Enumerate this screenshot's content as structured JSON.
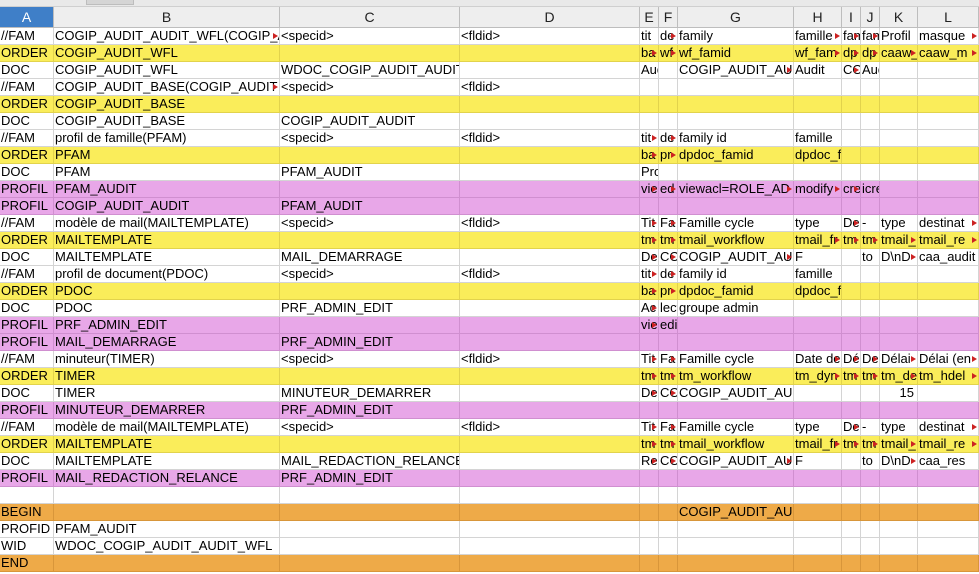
{
  "columns": [
    {
      "label": "A",
      "w": 54
    },
    {
      "label": "B",
      "w": 226
    },
    {
      "label": "C",
      "w": 180
    },
    {
      "label": "D",
      "w": 180
    },
    {
      "label": "E",
      "w": 19
    },
    {
      "label": "F",
      "w": 19
    },
    {
      "label": "G",
      "w": 116
    },
    {
      "label": "H",
      "w": 48
    },
    {
      "label": "I",
      "w": 19
    },
    {
      "label": "J",
      "w": 19
    },
    {
      "label": "K",
      "w": 38
    },
    {
      "label": "L",
      "w": 61
    }
  ],
  "selected_column": "A",
  "rows": [
    {
      "type": "FAM",
      "cells": [
        "//FAM",
        "COGIP_AUDIT_AUDIT_WFL(COGIP_AUDIT",
        "<specid>",
        "<fldid>",
        "tit",
        "de",
        "family",
        "famille",
        "fam",
        "fam",
        "Profil",
        "masque"
      ],
      "trunc": [
        1,
        5,
        7,
        8,
        9,
        11
      ]
    },
    {
      "type": "ORDER",
      "cells": [
        "ORDER",
        "COGIP_AUDIT_WFL",
        "",
        "",
        "ba",
        "wf",
        "wf_famid",
        "wf_fam",
        "dp",
        "dp",
        "caaw_",
        "caaw_m"
      ],
      "trunc": [
        4,
        5,
        7,
        8,
        9,
        10,
        11
      ]
    },
    {
      "type": "DOC",
      "cells": [
        "DOC",
        "COGIP_AUDIT_WFL",
        "WDOC_COGIP_AUDIT_AUDIT_WFL",
        "",
        "Audit",
        "",
        "COGIP_AUDIT_AU",
        "Audit",
        "CO",
        "Audit",
        "",
        ""
      ],
      "trunc": [
        6,
        8
      ]
    },
    {
      "type": "FAM",
      "cells": [
        "//FAM",
        "COGIP_AUDIT_BASE(COGIP_AUDIT",
        "<specid>",
        "<fldid>",
        "",
        "",
        "",
        "",
        "",
        "",
        "",
        ""
      ],
      "trunc": [
        1
      ]
    },
    {
      "type": "ORDER",
      "cells": [
        "ORDER",
        "COGIP_AUDIT_BASE",
        "",
        "",
        "",
        "",
        "",
        "",
        "",
        "",
        "",
        ""
      ],
      "trunc": []
    },
    {
      "type": "DOC",
      "cells": [
        "DOC",
        "COGIP_AUDIT_BASE",
        "COGIP_AUDIT_AUDIT",
        "",
        "",
        "",
        "",
        "",
        "",
        "",
        "",
        ""
      ],
      "trunc": []
    },
    {
      "type": "FAM",
      "cells": [
        "//FAM",
        "profil de famille(PFAM)",
        "<specid>",
        "<fldid>",
        "tit",
        "de",
        "family id",
        "famille",
        "",
        "",
        "",
        ""
      ],
      "trunc": [
        4,
        5
      ]
    },
    {
      "type": "ORDER",
      "cells": [
        "ORDER",
        "PFAM",
        "",
        "",
        "ba",
        "pr",
        "dpdoc_famid",
        "dpdoc_fam",
        "",
        "",
        "",
        ""
      ],
      "trunc": [
        4,
        5
      ]
    },
    {
      "type": "DOC",
      "cells": [
        "DOC",
        "PFAM",
        "PFAM_AUDIT",
        "",
        "Profil d'audit",
        "",
        "",
        "",
        "",
        "",
        "",
        ""
      ],
      "trunc": []
    },
    {
      "type": "PROFIL",
      "cells": [
        "PROFIL",
        "PFAM_AUDIT",
        "",
        "",
        "vie",
        "ed",
        "viewacl=ROLE_AD",
        "modify",
        "cre",
        "icreate=ROLE_RES",
        "",
        ""
      ],
      "trunc": [
        4,
        5,
        6,
        7,
        8
      ]
    },
    {
      "type": "PROFIL",
      "cells": [
        "PROFIL",
        "COGIP_AUDIT_AUDIT",
        "PFAM_AUDIT",
        "",
        "",
        "",
        "",
        "",
        "",
        "",
        "",
        ""
      ],
      "trunc": []
    },
    {
      "type": "FAM",
      "cells": [
        "//FAM",
        "modèle de mail(MAILTEMPLATE)",
        "<specid>",
        "<fldid>",
        "Tit",
        "Fa",
        "Famille cycle",
        "type",
        "De",
        "-",
        "type",
        "destinat"
      ],
      "trunc": [
        4,
        5,
        8,
        11
      ]
    },
    {
      "type": "ORDER",
      "cells": [
        "ORDER",
        "MAILTEMPLATE",
        "",
        "",
        "tm",
        "tm",
        "tmail_workflow",
        "tmail_fr",
        "tm",
        "tm",
        "tmail_",
        "tmail_re"
      ],
      "trunc": [
        4,
        5,
        7,
        8,
        9,
        10,
        11
      ]
    },
    {
      "type": "DOC",
      "cells": [
        "DOC",
        "MAILTEMPLATE",
        "MAIL_DEMARRAGE",
        "",
        "De",
        "CO",
        "COGIP_AUDIT_AU",
        "F",
        "",
        "to",
        "D\\nD",
        "caa_audit"
      ],
      "trunc": [
        4,
        5,
        6,
        10
      ]
    },
    {
      "type": "FAM",
      "cells": [
        "//FAM",
        "profil de document(PDOC)",
        "<specid>",
        "<fldid>",
        "tit",
        "de",
        "family id",
        "famille",
        "",
        "",
        "",
        ""
      ],
      "trunc": [
        4,
        5
      ]
    },
    {
      "type": "ORDER",
      "cells": [
        "ORDER",
        "PDOC",
        "",
        "",
        "ba",
        "pr",
        "dpdoc_famid",
        "dpdoc_fam",
        "",
        "",
        "",
        ""
      ],
      "trunc": [
        4,
        5
      ]
    },
    {
      "type": "DOC",
      "cells": [
        "DOC",
        "PDOC",
        "PRF_ADMIN_EDIT",
        "",
        "Ac",
        "lecture seule sauf pour",
        "groupe admin",
        "",
        "",
        "",
        "",
        ""
      ],
      "trunc": [
        4
      ]
    },
    {
      "type": "PROFIL",
      "cells": [
        "PROFIL",
        "PRF_ADMIN_EDIT",
        "",
        "",
        "vie",
        "edit=GADMIN",
        "",
        "",
        "",
        "",
        "",
        ""
      ],
      "trunc": [
        4
      ]
    },
    {
      "type": "PROFIL",
      "cells": [
        "PROFIL",
        "MAIL_DEMARRAGE",
        "PRF_ADMIN_EDIT",
        "",
        "",
        "",
        "",
        "",
        "",
        "",
        "",
        ""
      ],
      "trunc": []
    },
    {
      "type": "FAM",
      "cells": [
        "//FAM",
        "minuteur(TIMER)",
        "<specid>",
        "<fldid>",
        "Tit",
        "Fa",
        "Famille cycle",
        "Date de",
        "Dé",
        "De",
        "Délai",
        "Délai (en"
      ],
      "trunc": [
        4,
        5,
        7,
        8,
        9,
        10,
        11
      ]
    },
    {
      "type": "ORDER",
      "cells": [
        "ORDER",
        "TIMER",
        "",
        "",
        "tm",
        "tm",
        "tm_workflow",
        "tm_dyn",
        "tm",
        "tm",
        "tm_de",
        "tm_hdel"
      ],
      "trunc": [
        4,
        5,
        7,
        8,
        9,
        10,
        11
      ]
    },
    {
      "type": "DOC",
      "cells": [
        "DOC",
        "TIMER",
        "MINUTEUR_DEMARRER",
        "",
        "De",
        "CO",
        "COGIP_AUDIT_AUDIT_WFL",
        "",
        "",
        "",
        "15",
        ""
      ],
      "trunc": [
        4,
        5
      ]
    },
    {
      "type": "PROFIL",
      "cells": [
        "PROFIL",
        "MINUTEUR_DEMARRER",
        "PRF_ADMIN_EDIT",
        "",
        "",
        "",
        "",
        "",
        "",
        "",
        "",
        ""
      ],
      "trunc": []
    },
    {
      "type": "FAM",
      "cells": [
        "//FAM",
        "modèle de mail(MAILTEMPLATE)",
        "<specid>",
        "<fldid>",
        "Tit",
        "Fa",
        "Famille cycle",
        "type",
        "De",
        "-",
        "type",
        "destinat"
      ],
      "trunc": [
        4,
        5,
        8,
        11
      ]
    },
    {
      "type": "ORDER",
      "cells": [
        "ORDER",
        "MAILTEMPLATE",
        "",
        "",
        "tm",
        "tm",
        "tmail_workflow",
        "tmail_fr",
        "tm",
        "tm",
        "tmail_",
        "tmail_re"
      ],
      "trunc": [
        4,
        5,
        7,
        8,
        9,
        10,
        11
      ]
    },
    {
      "type": "DOC",
      "cells": [
        "DOC",
        "MAILTEMPLATE",
        "MAIL_REDACTION_RELANCE",
        "",
        "Re",
        "CO",
        "COGIP_AUDIT_AU",
        "F",
        "",
        "to",
        "D\\nD",
        "caa_res"
      ],
      "trunc": [
        4,
        5,
        6,
        10
      ]
    },
    {
      "type": "PROFIL",
      "cells": [
        "PROFIL",
        "MAIL_REDACTION_RELANCE",
        "PRF_ADMIN_EDIT",
        "",
        "",
        "",
        "",
        "",
        "",
        "",
        "",
        ""
      ],
      "trunc": []
    },
    {
      "type": "EMPTY",
      "cells": [
        "",
        "",
        "",
        "",
        "",
        "",
        "",
        "",
        "",
        "",
        "",
        ""
      ],
      "trunc": []
    },
    {
      "type": "BEGIN",
      "cells": [
        "BEGIN",
        "",
        "",
        "",
        "",
        "",
        "COGIP_AUDIT_AUDIT",
        "",
        "",
        "",
        "",
        ""
      ],
      "trunc": []
    },
    {
      "type": "PROFID",
      "cells": [
        "PROFID",
        "PFAM_AUDIT",
        "",
        "",
        "",
        "",
        "",
        "",
        "",
        "",
        "",
        ""
      ],
      "trunc": []
    },
    {
      "type": "WID",
      "cells": [
        "WID",
        "WDOC_COGIP_AUDIT_AUDIT_WFL",
        "",
        "",
        "",
        "",
        "",
        "",
        "",
        "",
        "",
        ""
      ],
      "trunc": []
    },
    {
      "type": "END",
      "cells": [
        "END",
        "",
        "",
        "",
        "",
        "",
        "",
        "",
        "",
        "",
        "",
        ""
      ],
      "trunc": []
    }
  ]
}
